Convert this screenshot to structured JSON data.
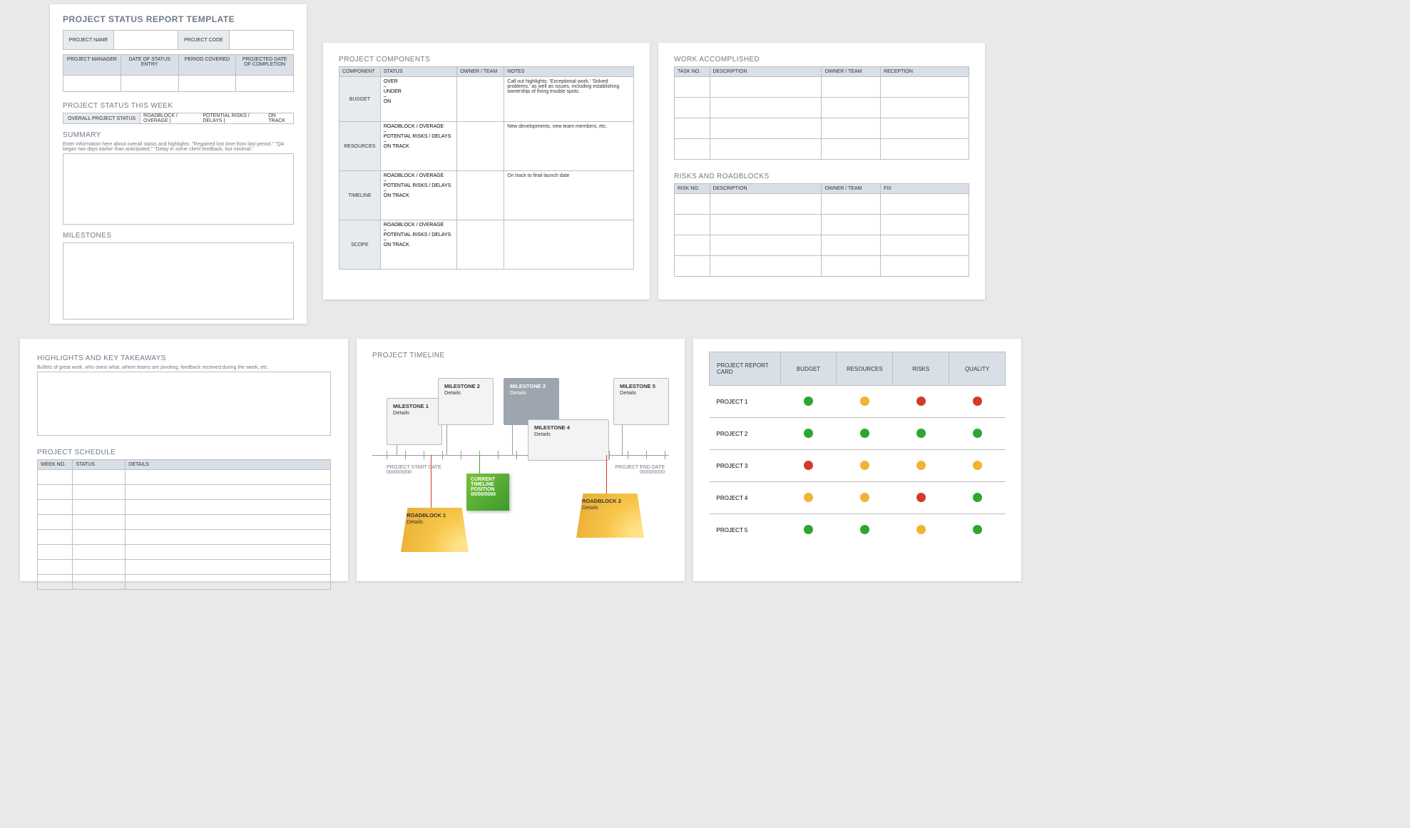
{
  "page1": {
    "title": "PROJECT STATUS REPORT TEMPLATE",
    "row1": {
      "project_name": "PROJECT NAME",
      "project_code": "PROJECT CODE"
    },
    "row2": [
      "PROJECT MANAGER",
      "DATE OF STATUS ENTRY",
      "PERIOD COVERED",
      "PROJECTED DATE OF COMPLETION"
    ],
    "status_this_week": "PROJECT STATUS THIS WEEK",
    "overall_status_label": "OVERALL PROJECT STATUS",
    "legend": [
      "ROADBLOCK / OVERAGE   |",
      "POTENTIAL RISKS / DELAYS   |",
      "ON TRACK"
    ],
    "summary_title": "SUMMARY",
    "summary_hint": "Enter information here about overall status and highlights: \"Regained lost time from last period.\" \"QA began two days earlier than anticipated.\" \"Delay in some client feedback, but minimal.\"",
    "milestones_title": "MILESTONES"
  },
  "page2": {
    "title": "PROJECT COMPONENTS",
    "headers": [
      "COMPONENT",
      "STATUS",
      "OWNER / TEAM",
      "NOTES"
    ],
    "rows": [
      {
        "component": "BUDGET",
        "status": "OVER\n–\nUNDER\n–\nON",
        "notes": "Call out highlights: 'Exceptional work,' 'Solved problems,' as well as issues, including establishing ownership of fixing trouble spots."
      },
      {
        "component": "RESOURCES",
        "status": "ROADBLOCK / OVERAGE\n–\nPOTENTIAL RISKS / DELAYS\n–\nON TRACK",
        "notes": "New developments, new team members, etc."
      },
      {
        "component": "TIMELINE",
        "status": "ROADBLOCK / OVERAGE\n–\nPOTENTIAL RISKS / DELAYS\n–\nON TRACK",
        "notes": "On track to final launch date"
      },
      {
        "component": "SCOPE",
        "status": "ROADBLOCK / OVERAGE\n–\nPOTENTIAL RISKS / DELAYS\n–\nON TRACK",
        "notes": ""
      }
    ]
  },
  "page3": {
    "work_title": "WORK ACCOMPLISHED",
    "work_headers": [
      "TASK NO.",
      "DESCRIPTION",
      "OWNER / TEAM",
      "RECEPTION"
    ],
    "risks_title": "RISKS AND ROADBLOCKS",
    "risks_headers": [
      "RISK NO.",
      "DESCRIPTION",
      "OWNER / TEAM",
      "FIX"
    ]
  },
  "page4": {
    "hl_title": "HIGHLIGHTS AND KEY TAKEAWAYS",
    "hl_hint": "Bullets of great work, who owns what, where teams are pivoting, feedback received during the week, etc.",
    "sched_title": "PROJECT SCHEDULE",
    "sched_headers": [
      "WEEK NO.",
      "STATUS",
      "DETAILS"
    ]
  },
  "page5": {
    "title": "PROJECT TIMELINE",
    "start_lbl": "PROJECT START DATE",
    "start_date": "00/00/0000",
    "end_lbl": "PROJECT END DATE",
    "end_date": "00/00/0000",
    "milestones": [
      "MILESTONE 1",
      "MILESTONE 2",
      "MILESTONE 3",
      "MILESTONE 4",
      "MILESTONE 5"
    ],
    "details": "Details",
    "roadblocks": [
      "ROADBLOCK 1",
      "ROADBLOCK 2"
    ],
    "current": "CURRENT TIMELINE POSITION",
    "current_date": "00/00/0000"
  },
  "page6": {
    "headers": [
      "PROJECT REPORT CARD",
      "BUDGET",
      "RESOURCES",
      "RISKS",
      "QUALITY"
    ],
    "rows": [
      {
        "name": "PROJECT 1",
        "dots": [
          "g",
          "y",
          "r",
          "r"
        ]
      },
      {
        "name": "PROJECT 2",
        "dots": [
          "g",
          "g",
          "g",
          "g"
        ]
      },
      {
        "name": "PROJECT 3",
        "dots": [
          "r",
          "y",
          "y",
          "y"
        ]
      },
      {
        "name": "PROJECT 4",
        "dots": [
          "y",
          "y",
          "r",
          "g"
        ]
      },
      {
        "name": "PROJECT 5",
        "dots": [
          "g",
          "g",
          "y",
          "g"
        ]
      }
    ]
  }
}
